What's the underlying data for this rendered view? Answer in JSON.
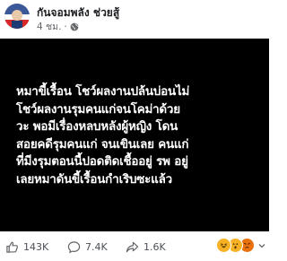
{
  "post": {
    "author_name": "กันจอมพลัง ช่วยสู้",
    "time_ago": "4 ชม.",
    "visibility_dot": "·",
    "image_text": "หมาขี้เรื้อน โชว์ผลงานปล้นบ่อนไม่\nโชว์ผลงานรุมคนแก่จนโคม่าด้วย\nวะ พอมีเรื่องหลบหลังผู้หญิง โดน\nสอยคดีรุมคนแก่ จนเขินเลย คนแก่\nที่มีงรุมตอนนี้ปอดติดเชื้ออยู่ รพ อยู่\nเลยหมาดันขี้เรื้อนกำเริบซะแล้ว"
  },
  "reactions": {
    "likes": "143K",
    "comments": "7.4K",
    "shares": "1.6K"
  },
  "icons": {
    "avatar": "profile-avatar",
    "globe": "globe-icon",
    "like": "thumbs-up-icon",
    "comment": "comment-bubble-icon",
    "share": "share-arrow-icon",
    "emoji_haha": "haha-emoji-icon",
    "emoji_wow": "wow-emoji-icon",
    "emoji_angry": "angry-emoji-icon"
  },
  "colors": {
    "card_background": "#000000",
    "card_text": "#ffffff",
    "author": "#1c1e21",
    "meta": "#65676b"
  }
}
